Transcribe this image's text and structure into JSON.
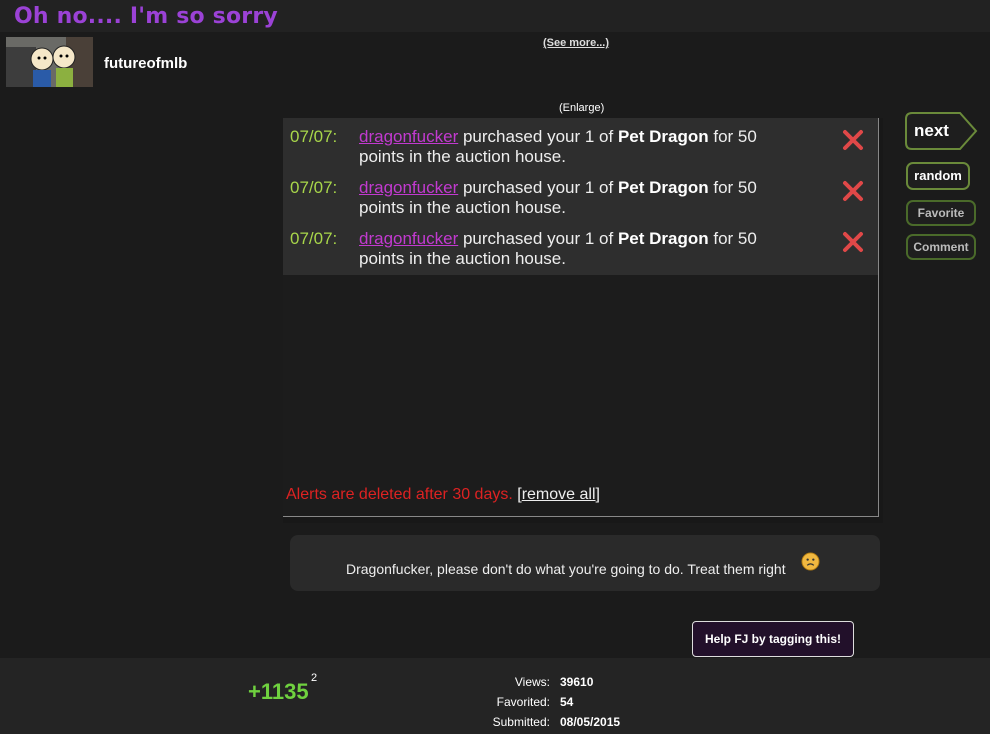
{
  "header": {
    "title": "Oh no.... I'm so sorry"
  },
  "author": {
    "username": "futureofmlb",
    "see_more": "(See more...)"
  },
  "enlarge": "(Enlarge)",
  "alerts": {
    "items": [
      {
        "date": "07/07:",
        "user": "dragonfucker",
        "text_before": " purchased your 1 of ",
        "item": "Pet Dragon",
        "text_after": " for 50 points in the auction house."
      },
      {
        "date": "07/07:",
        "user": "dragonfucker",
        "text_before": " purchased your 1 of ",
        "item": "Pet Dragon",
        "text_after": " for 50 points in the auction house."
      },
      {
        "date": "07/07:",
        "user": "dragonfucker",
        "text_before": " purchased your 1 of ",
        "item": "Pet Dragon",
        "text_after": " for 50 points in the auction house."
      }
    ],
    "footer_note": "Alerts are deleted after 30 days.",
    "remove_all": "remove all"
  },
  "sidebar": {
    "next": "next",
    "random": "random",
    "favorite": "Favorite",
    "comment": "Comment"
  },
  "description": "Dragonfucker, please don't do what you're going to do. Treat them right",
  "tag_help": "Help FJ by tagging this!",
  "stats": {
    "score": "+1135",
    "score_sup": "2",
    "views_label": "Views:",
    "views": "39610",
    "favorited_label": "Favorited:",
    "favorited": "54",
    "submitted_label": "Submitted:",
    "submitted": "08/05/2015"
  },
  "colors": {
    "title": "#9b42d6",
    "score": "#6fd13f",
    "alert_date": "#a8d64a",
    "alert_user": "#c23ad0",
    "footer_note": "#dd2222"
  }
}
